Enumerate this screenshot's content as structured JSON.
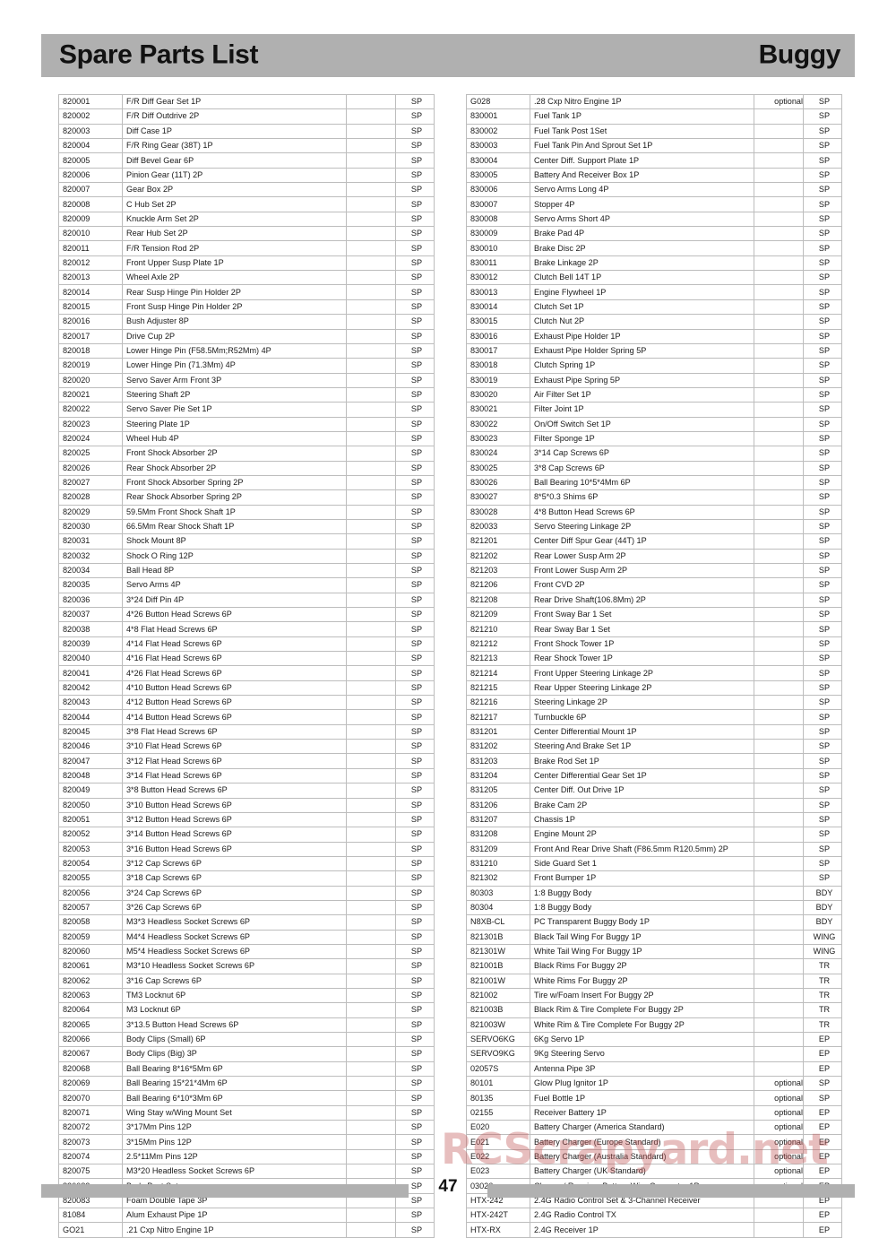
{
  "header": {
    "title_left": "Spare Parts List",
    "title_right": "Buggy",
    "band_color": "#b0b0b0"
  },
  "watermark": {
    "text": "RCScrapyard.net",
    "color": "#c45c5c"
  },
  "footer": {
    "page_number": "47",
    "bar_color": "#b0b0b0"
  },
  "table_columns": [
    "code",
    "description",
    "optional",
    "type"
  ],
  "left_table": [
    {
      "code": "820001",
      "description": "F/R Diff Gear Set 1P",
      "optional": "",
      "type": "SP"
    },
    {
      "code": "820002",
      "description": "F/R Diff Outdrive 2P",
      "optional": "",
      "type": "SP"
    },
    {
      "code": "820003",
      "description": "Diff Case 1P",
      "optional": "",
      "type": "SP"
    },
    {
      "code": "820004",
      "description": "F/R Ring Gear (38T) 1P",
      "optional": "",
      "type": "SP"
    },
    {
      "code": "820005",
      "description": "Diff Bevel Gear 6P",
      "optional": "",
      "type": "SP"
    },
    {
      "code": "820006",
      "description": "Pinion Gear (11T) 2P",
      "optional": "",
      "type": "SP"
    },
    {
      "code": "820007",
      "description": "Gear Box 2P",
      "optional": "",
      "type": "SP"
    },
    {
      "code": "820008",
      "description": "C Hub Set 2P",
      "optional": "",
      "type": "SP"
    },
    {
      "code": "820009",
      "description": "Knuckle Arm Set 2P",
      "optional": "",
      "type": "SP"
    },
    {
      "code": "820010",
      "description": "Rear Hub Set 2P",
      "optional": "",
      "type": "SP"
    },
    {
      "code": "820011",
      "description": "F/R Tension Rod 2P",
      "optional": "",
      "type": "SP"
    },
    {
      "code": "820012",
      "description": "Front Upper Susp Plate 1P",
      "optional": "",
      "type": "SP"
    },
    {
      "code": "820013",
      "description": "Wheel Axle 2P",
      "optional": "",
      "type": "SP"
    },
    {
      "code": "820014",
      "description": "Rear Susp Hinge Pin Holder 2P",
      "optional": "",
      "type": "SP"
    },
    {
      "code": "820015",
      "description": "Front Susp Hinge Pin Holder 2P",
      "optional": "",
      "type": "SP"
    },
    {
      "code": "820016",
      "description": "Bush Adjuster 8P",
      "optional": "",
      "type": "SP"
    },
    {
      "code": "820017",
      "description": "Drive Cup 2P",
      "optional": "",
      "type": "SP"
    },
    {
      "code": "820018",
      "description": "Lower Hinge Pin (F58.5Mm;R52Mm) 4P",
      "optional": "",
      "type": "SP"
    },
    {
      "code": "820019",
      "description": "Lower Hinge Pin (71.3Mm) 4P",
      "optional": "",
      "type": "SP"
    },
    {
      "code": "820020",
      "description": "Servo Saver Arm Front 3P",
      "optional": "",
      "type": "SP"
    },
    {
      "code": "820021",
      "description": "Steering Shaft 2P",
      "optional": "",
      "type": "SP"
    },
    {
      "code": "820022",
      "description": "Servo Saver Pie Set 1P",
      "optional": "",
      "type": "SP"
    },
    {
      "code": "820023",
      "description": "Steering Plate 1P",
      "optional": "",
      "type": "SP"
    },
    {
      "code": "820024",
      "description": "Wheel Hub 4P",
      "optional": "",
      "type": "SP"
    },
    {
      "code": "820025",
      "description": "Front Shock Absorber 2P",
      "optional": "",
      "type": "SP"
    },
    {
      "code": "820026",
      "description": "Rear Shock Absorber 2P",
      "optional": "",
      "type": "SP"
    },
    {
      "code": "820027",
      "description": "Front Shock Absorber Spring 2P",
      "optional": "",
      "type": "SP"
    },
    {
      "code": "820028",
      "description": "Rear Shock Absorber Spring 2P",
      "optional": "",
      "type": "SP"
    },
    {
      "code": "820029",
      "description": "59.5Mm Front Shock Shaft 1P",
      "optional": "",
      "type": "SP"
    },
    {
      "code": "820030",
      "description": "66.5Mm Rear Shock Shaft 1P",
      "optional": "",
      "type": "SP"
    },
    {
      "code": "820031",
      "description": "Shock Mount 8P",
      "optional": "",
      "type": "SP"
    },
    {
      "code": "820032",
      "description": "Shock O Ring 12P",
      "optional": "",
      "type": "SP"
    },
    {
      "code": "820034",
      "description": "Ball Head 8P",
      "optional": "",
      "type": "SP"
    },
    {
      "code": "820035",
      "description": "Servo Arms 4P",
      "optional": "",
      "type": "SP"
    },
    {
      "code": "820036",
      "description": "3*24 Diff Pin 4P",
      "optional": "",
      "type": "SP"
    },
    {
      "code": "820037",
      "description": "4*26 Button Head Screws 6P",
      "optional": "",
      "type": "SP"
    },
    {
      "code": "820038",
      "description": "4*8 Flat Head Screws 6P",
      "optional": "",
      "type": "SP"
    },
    {
      "code": "820039",
      "description": "4*14 Flat Head Screws 6P",
      "optional": "",
      "type": "SP"
    },
    {
      "code": "820040",
      "description": "4*16 Flat Head Screws 6P",
      "optional": "",
      "type": "SP"
    },
    {
      "code": "820041",
      "description": "4*26 Flat Head Screws 6P",
      "optional": "",
      "type": "SP"
    },
    {
      "code": "820042",
      "description": "4*10 Button Head Screws 6P",
      "optional": "",
      "type": "SP"
    },
    {
      "code": "820043",
      "description": "4*12 Button Head Screws 6P",
      "optional": "",
      "type": "SP"
    },
    {
      "code": "820044",
      "description": "4*14 Button Head Screws 6P",
      "optional": "",
      "type": "SP"
    },
    {
      "code": "820045",
      "description": "3*8 Flat Head Screws 6P",
      "optional": "",
      "type": "SP"
    },
    {
      "code": "820046",
      "description": "3*10 Flat Head Screws 6P",
      "optional": "",
      "type": "SP"
    },
    {
      "code": "820047",
      "description": "3*12 Flat Head Screws 6P",
      "optional": "",
      "type": "SP"
    },
    {
      "code": "820048",
      "description": "3*14 Flat Head Screws 6P",
      "optional": "",
      "type": "SP"
    },
    {
      "code": "820049",
      "description": "3*8 Button Head Screws 6P",
      "optional": "",
      "type": "SP"
    },
    {
      "code": "820050",
      "description": "3*10 Button Head Screws 6P",
      "optional": "",
      "type": "SP"
    },
    {
      "code": "820051",
      "description": "3*12 Button Head Screws 6P",
      "optional": "",
      "type": "SP"
    },
    {
      "code": "820052",
      "description": "3*14 Button Head Screws 6P",
      "optional": "",
      "type": "SP"
    },
    {
      "code": "820053",
      "description": "3*16 Button Head Screws 6P",
      "optional": "",
      "type": "SP"
    },
    {
      "code": "820054",
      "description": "3*12 Cap Screws 6P",
      "optional": "",
      "type": "SP"
    },
    {
      "code": "820055",
      "description": "3*18 Cap Screws 6P",
      "optional": "",
      "type": "SP"
    },
    {
      "code": "820056",
      "description": "3*24 Cap Screws 6P",
      "optional": "",
      "type": "SP"
    },
    {
      "code": "820057",
      "description": "3*26 Cap Screws 6P",
      "optional": "",
      "type": "SP"
    },
    {
      "code": "820058",
      "description": "M3*3 Headless Socket Screws 6P",
      "optional": "",
      "type": "SP"
    },
    {
      "code": "820059",
      "description": "M4*4 Headless Socket Screws 6P",
      "optional": "",
      "type": "SP"
    },
    {
      "code": "820060",
      "description": "M5*4 Headless Socket Screws 6P",
      "optional": "",
      "type": "SP"
    },
    {
      "code": "820061",
      "description": "M3*10 Headless Socket Screws 6P",
      "optional": "",
      "type": "SP"
    },
    {
      "code": "820062",
      "description": "3*16 Cap Screws 6P",
      "optional": "",
      "type": "SP"
    },
    {
      "code": "820063",
      "description": "TM3 Locknut 6P",
      "optional": "",
      "type": "SP"
    },
    {
      "code": "820064",
      "description": "M3 Locknut 6P",
      "optional": "",
      "type": "SP"
    },
    {
      "code": "820065",
      "description": "3*13.5 Button Head Screws 6P",
      "optional": "",
      "type": "SP"
    },
    {
      "code": "820066",
      "description": "Body Clips (Small) 6P",
      "optional": "",
      "type": "SP"
    },
    {
      "code": "820067",
      "description": "Body Clips (Big) 3P",
      "optional": "",
      "type": "SP"
    },
    {
      "code": "820068",
      "description": "Ball Bearing 8*16*5Mm 6P",
      "optional": "",
      "type": "SP"
    },
    {
      "code": "820069",
      "description": "Ball Bearing 15*21*4Mm 6P",
      "optional": "",
      "type": "SP"
    },
    {
      "code": "820070",
      "description": "Ball Bearing 6*10*3Mm 6P",
      "optional": "",
      "type": "SP"
    },
    {
      "code": "820071",
      "description": "Wing Stay w/Wing Mount  Set",
      "optional": "",
      "type": "SP"
    },
    {
      "code": "820072",
      "description": "3*17Mm Pins 12P",
      "optional": "",
      "type": "SP"
    },
    {
      "code": "820073",
      "description": "3*15Mm Pins 12P",
      "optional": "",
      "type": "SP"
    },
    {
      "code": "820074",
      "description": "2.5*11Mm Pins 12P",
      "optional": "",
      "type": "SP"
    },
    {
      "code": "820075",
      "description": "M3*20 Headless Socket Screws 6P",
      "optional": "",
      "type": "SP"
    },
    {
      "code": "820082",
      "description": "Body Post  Set",
      "optional": "",
      "type": "SP"
    },
    {
      "code": "820083",
      "description": "Foam Double Tape 3P",
      "optional": "",
      "type": "SP"
    },
    {
      "code": "81084",
      "description": "Alum Exhaust Pipe 1P",
      "optional": "",
      "type": "SP"
    },
    {
      "code": "GO21",
      "description": ".21 Cxp Nitro Engine 1P",
      "optional": "",
      "type": "SP"
    }
  ],
  "right_table": [
    {
      "code": "G028",
      "description": ".28 Cxp Nitro Engine 1P",
      "optional": "optional",
      "type": "SP"
    },
    {
      "code": "830001",
      "description": "Fuel Tank 1P",
      "optional": "",
      "type": "SP"
    },
    {
      "code": "830002",
      "description": "Fuel Tank Post 1Set",
      "optional": "",
      "type": "SP"
    },
    {
      "code": "830003",
      "description": "Fuel Tank Pin And Sprout Set 1P",
      "optional": "",
      "type": "SP"
    },
    {
      "code": "830004",
      "description": "Center Diff. Support Plate 1P",
      "optional": "",
      "type": "SP"
    },
    {
      "code": "830005",
      "description": "Battery And Receiver Box 1P",
      "optional": "",
      "type": "SP"
    },
    {
      "code": "830006",
      "description": "Servo Arms Long 4P",
      "optional": "",
      "type": "SP"
    },
    {
      "code": "830007",
      "description": "Stopper 4P",
      "optional": "",
      "type": "SP"
    },
    {
      "code": "830008",
      "description": "Servo Arms Short 4P",
      "optional": "",
      "type": "SP"
    },
    {
      "code": "830009",
      "description": "Brake Pad 4P",
      "optional": "",
      "type": "SP"
    },
    {
      "code": "830010",
      "description": "Brake Disc 2P",
      "optional": "",
      "type": "SP"
    },
    {
      "code": "830011",
      "description": "Brake Linkage 2P",
      "optional": "",
      "type": "SP"
    },
    {
      "code": "830012",
      "description": "Clutch Bell 14T 1P",
      "optional": "",
      "type": "SP"
    },
    {
      "code": "830013",
      "description": "Engine Flywheel 1P",
      "optional": "",
      "type": "SP"
    },
    {
      "code": "830014",
      "description": "Clutch Set 1P",
      "optional": "",
      "type": "SP"
    },
    {
      "code": "830015",
      "description": "Clutch Nut 2P",
      "optional": "",
      "type": "SP"
    },
    {
      "code": "830016",
      "description": "Exhaust Pipe Holder 1P",
      "optional": "",
      "type": "SP"
    },
    {
      "code": "830017",
      "description": "Exhaust Pipe Holder Spring 5P",
      "optional": "",
      "type": "SP"
    },
    {
      "code": "830018",
      "description": "Clutch Spring 1P",
      "optional": "",
      "type": "SP"
    },
    {
      "code": "830019",
      "description": "Exhaust Pipe Spring 5P",
      "optional": "",
      "type": "SP"
    },
    {
      "code": "830020",
      "description": "Air Filter Set 1P",
      "optional": "",
      "type": "SP"
    },
    {
      "code": "830021",
      "description": "Filter Joint 1P",
      "optional": "",
      "type": "SP"
    },
    {
      "code": "830022",
      "description": "On/Off Switch Set 1P",
      "optional": "",
      "type": "SP"
    },
    {
      "code": "830023",
      "description": "Filter Sponge 1P",
      "optional": "",
      "type": "SP"
    },
    {
      "code": "830024",
      "description": "3*14 Cap Screws 6P",
      "optional": "",
      "type": "SP"
    },
    {
      "code": "830025",
      "description": "3*8 Cap Screws 6P",
      "optional": "",
      "type": "SP"
    },
    {
      "code": "830026",
      "description": "Ball Bearing 10*5*4Mm 6P",
      "optional": "",
      "type": "SP"
    },
    {
      "code": "830027",
      "description": "8*5*0.3 Shims 6P",
      "optional": "",
      "type": "SP"
    },
    {
      "code": "830028",
      "description": "4*8 Button Head Screws 6P",
      "optional": "",
      "type": "SP"
    },
    {
      "code": "820033",
      "description": "Servo Steering Linkage 2P",
      "optional": "",
      "type": "SP"
    },
    {
      "code": "821201",
      "description": "Center Diff Spur Gear (44T) 1P",
      "optional": "",
      "type": "SP"
    },
    {
      "code": "821202",
      "description": "Rear Lower Susp Arm 2P",
      "optional": "",
      "type": "SP"
    },
    {
      "code": "821203",
      "description": "Front Lower Susp Arm 2P",
      "optional": "",
      "type": "SP"
    },
    {
      "code": "821206",
      "description": "Front CVD 2P",
      "optional": "",
      "type": "SP"
    },
    {
      "code": "821208",
      "description": "Rear Drive Shaft(106.8Mm) 2P",
      "optional": "",
      "type": "SP"
    },
    {
      "code": "821209",
      "description": "Front Sway Bar 1 Set",
      "optional": "",
      "type": "SP"
    },
    {
      "code": "821210",
      "description": "Rear Sway Bar 1 Set",
      "optional": "",
      "type": "SP"
    },
    {
      "code": "821212",
      "description": "Front Shock Tower 1P",
      "optional": "",
      "type": "SP"
    },
    {
      "code": "821213",
      "description": "Rear Shock Tower 1P",
      "optional": "",
      "type": "SP"
    },
    {
      "code": "821214",
      "description": "Front Upper Steering Linkage 2P",
      "optional": "",
      "type": "SP"
    },
    {
      "code": "821215",
      "description": "Rear Upper Steering Linkage 2P",
      "optional": "",
      "type": "SP"
    },
    {
      "code": "821216",
      "description": "Steering Linkage 2P",
      "optional": "",
      "type": "SP"
    },
    {
      "code": "821217",
      "description": "Turnbuckle 6P",
      "optional": "",
      "type": "SP"
    },
    {
      "code": "831201",
      "description": "Center Differential Mount 1P",
      "optional": "",
      "type": "SP"
    },
    {
      "code": "831202",
      "description": "Steering And Brake Set 1P",
      "optional": "",
      "type": "SP"
    },
    {
      "code": "831203",
      "description": "Brake Rod Set 1P",
      "optional": "",
      "type": "SP"
    },
    {
      "code": "831204",
      "description": "Center Differential Gear Set 1P",
      "optional": "",
      "type": "SP"
    },
    {
      "code": "831205",
      "description": "Center Diff. Out Drive 1P",
      "optional": "",
      "type": "SP"
    },
    {
      "code": "831206",
      "description": "Brake Cam 2P",
      "optional": "",
      "type": "SP"
    },
    {
      "code": "831207",
      "description": "Chassis 1P",
      "optional": "",
      "type": "SP"
    },
    {
      "code": "831208",
      "description": "Engine Mount 2P",
      "optional": "",
      "type": "SP"
    },
    {
      "code": "831209",
      "description": "Front And Rear Drive Shaft (F86.5mm R120.5mm) 2P",
      "optional": "",
      "type": "SP"
    },
    {
      "code": "831210",
      "description": "Side Guard Set 1",
      "optional": "",
      "type": "SP"
    },
    {
      "code": "821302",
      "description": "Front Bumper  1P",
      "optional": "",
      "type": "SP"
    },
    {
      "code": "80303",
      "description": "1:8 Buggy Body",
      "optional": "",
      "type": "BDY"
    },
    {
      "code": "80304",
      "description": "1:8 Buggy Body",
      "optional": "",
      "type": "BDY"
    },
    {
      "code": "N8XB-CL",
      "description": "PC Transparent Buggy Body 1P",
      "optional": "",
      "type": "BDY"
    },
    {
      "code": "821301B",
      "description": "Black Tail Wing For Buggy  1P",
      "optional": "",
      "type": "WING"
    },
    {
      "code": "821301W",
      "description": "White Tail Wing For Buggy  1P",
      "optional": "",
      "type": "WING"
    },
    {
      "code": "821001B",
      "description": "Black Rims For Buggy  2P",
      "optional": "",
      "type": "TR"
    },
    {
      "code": "821001W",
      "description": "White Rims For Buggy  2P",
      "optional": "",
      "type": "TR"
    },
    {
      "code": "821002",
      "description": "Tire w/Foam Insert For Buggy 2P",
      "optional": "",
      "type": "TR"
    },
    {
      "code": "821003B",
      "description": "Black Rim & Tire Complete For Buggy  2P",
      "optional": "",
      "type": "TR"
    },
    {
      "code": "821003W",
      "description": "White Rim & Tire Complete For Buggy  2P",
      "optional": "",
      "type": "TR"
    },
    {
      "code": "SERVO6KG",
      "description": "6Kg Servo 1P",
      "optional": "",
      "type": "EP"
    },
    {
      "code": "SERVO9KG",
      "description": "9Kg Steering Servo",
      "optional": "",
      "type": "EP"
    },
    {
      "code": "02057S",
      "description": "Antenna Pipe 3P",
      "optional": "",
      "type": "EP"
    },
    {
      "code": "80101",
      "description": "Glow Plug Ignitor 1P",
      "optional": "optional",
      "type": "SP"
    },
    {
      "code": "80135",
      "description": "Fuel Bottle 1P",
      "optional": "optional",
      "type": "SP"
    },
    {
      "code": "02155",
      "description": "Receiver Battery 1P",
      "optional": "optional",
      "type": "EP"
    },
    {
      "code": "E020",
      "description": "Battery Charger (America Standard)",
      "optional": "optional",
      "type": "EP"
    },
    {
      "code": "E021",
      "description": "Battery Charger (Europe Standard)",
      "optional": "optional",
      "type": "EP"
    },
    {
      "code": "E022",
      "description": "Battery Charger (Australia Standard)",
      "optional": "optional",
      "type": "EP"
    },
    {
      "code": "E023",
      "description": "Battery Charger (UK Standard)",
      "optional": "optional",
      "type": "EP"
    },
    {
      "code": "03026",
      "description": "Charger/ Receiver Battery Wire Connector 1P",
      "optional": "optional",
      "type": "EP"
    },
    {
      "code": "HTX-242",
      "description": "2.4G Radio Control Set & 3-Channel Receiver",
      "optional": "",
      "type": "EP"
    },
    {
      "code": "HTX-242T",
      "description": "2.4G Radio Control TX",
      "optional": "",
      "type": "EP"
    },
    {
      "code": "HTX-RX",
      "description": "2.4G Receiver 1P",
      "optional": "",
      "type": "EP"
    }
  ]
}
